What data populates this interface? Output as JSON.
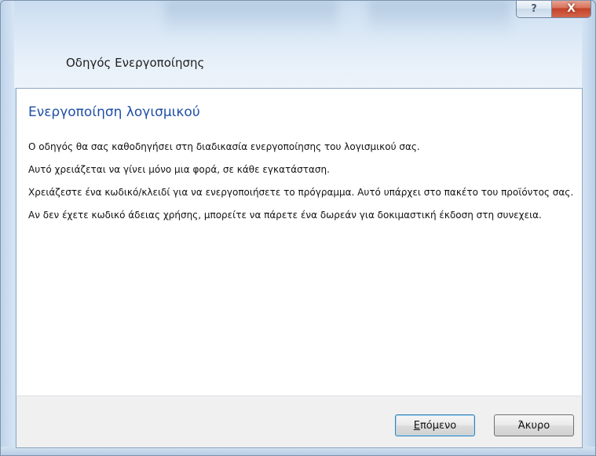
{
  "window": {
    "caption_buttons": {
      "help_label": "?",
      "close_label": "X"
    },
    "title": "Οδηγός Ενεργοποίησης"
  },
  "content": {
    "heading": "Ενεργοποίηση λογισμικού",
    "paragraphs": [
      "Ο οδηγός θα σας καθοδηγήσει στη διαδικασία ενεργοποίησης του λογισμικού σας.",
      "Αυτό χρειάζεται να γίνει μόνο μια φορά, σε κάθε εγκατάσταση.",
      "Χρειάζεστε ένα κωδικό/κλειδί για να ενεργοποιήσετε το πρόγραμμα. Αυτό υπάρχει στο πακέτο του προϊόντος σας.",
      "Αν δεν έχετε κωδικό άδειας χρήσης, μπορείτε να πάρετε ένα δωρεάν για δοκιμαστική έκδοση στη συνεχεια."
    ]
  },
  "buttons": {
    "next_label": "Επόμενο",
    "cancel_label": "Άκυρο"
  },
  "colors": {
    "heading": "#1f4ea6",
    "close_button": "#c4432a",
    "frame": "#cfe0f1"
  }
}
